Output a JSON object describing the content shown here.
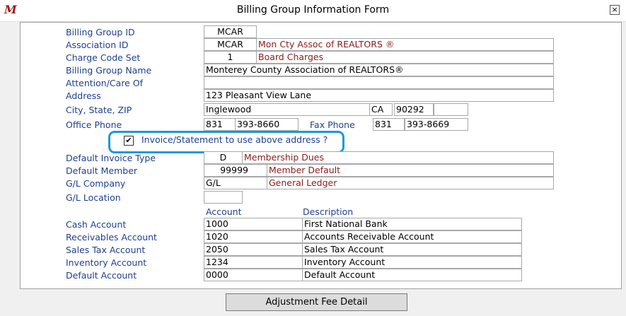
{
  "window": {
    "title": "Billing Group Information Form",
    "logo": "M",
    "close": "×"
  },
  "labels": {
    "billing_group_id": "Billing Group ID",
    "association_id": "Association ID",
    "charge_code_set": "Charge Code Set",
    "billing_group_name": "Billing Group Name",
    "attention": "Attention/Care Of",
    "address": "Address",
    "city_state_zip": "City, State, ZIP",
    "office_phone": "Office Phone",
    "fax_phone": "Fax Phone",
    "default_invoice_type": "Default Invoice Type",
    "default_member": "Default Member",
    "gl_company": "G/L Company",
    "gl_location": "G/L Location",
    "account_header": "Account",
    "description_header": "Description"
  },
  "fields": {
    "billing_group_id": "MCAR",
    "association_id": "MCAR",
    "association_desc": "Mon Cty Assoc of REALTORS ®",
    "charge_code_set": "1",
    "charge_code_desc": "Board Charges",
    "billing_group_name": "Monterey County Association of REALTORS®",
    "attention": "",
    "address": "123 Pleasant View Lane",
    "city": "Inglewood",
    "state": "CA",
    "zip": "90292",
    "zip_ext": "",
    "office_area": "831",
    "office_number": "393-8660",
    "fax_area": "831",
    "fax_number": "393-8669",
    "invoice_type": "D",
    "invoice_type_desc": "Membership Dues",
    "default_member": "99999",
    "default_member_desc": "Member Default",
    "gl_company": "G/L",
    "gl_company_desc": "General Ledger",
    "gl_location": ""
  },
  "checkbox": {
    "checked": true,
    "mark": "✔",
    "label": "Invoice/Statement to use above address ?"
  },
  "accounts": [
    {
      "label": "Cash Account",
      "account": "1000",
      "description": "First National Bank"
    },
    {
      "label": "Receivables Account",
      "account": "1020",
      "description": "Accounts Receivable Account"
    },
    {
      "label": "Sales Tax Account",
      "account": "2050",
      "description": "Sales Tax Account"
    },
    {
      "label": "Inventory Account",
      "account": "1234",
      "description": "Inventory Account"
    },
    {
      "label": "Default Account",
      "account": "0000",
      "description": "Default Account"
    }
  ],
  "buttons": {
    "adjustment_fee_detail": "Adjustment Fee Detail"
  },
  "colors": {
    "label": "#1f3f8f",
    "description": "#8b1a1a",
    "highlight": "#1a9ad6"
  }
}
